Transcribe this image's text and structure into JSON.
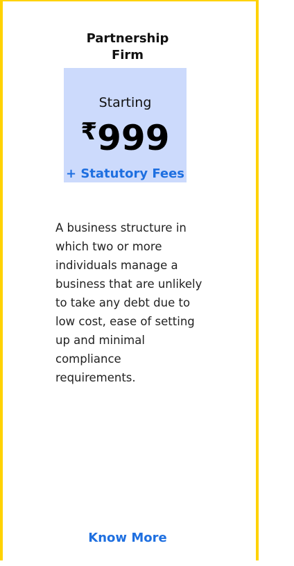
{
  "card": {
    "title": "Partnership Firm",
    "price": {
      "starting_label": "Starting",
      "currency_symbol": "₹",
      "amount": "999",
      "fees_label": "+ Statutory Fees"
    },
    "description": "A business structure in which two or more individuals manage a business that are unlikely to take any debt due to low cost, ease of setting up and minimal compliance requirements.",
    "cta_label": "Know More"
  },
  "colors": {
    "border": "#FFD200",
    "price_box_bg": "#CCDAFC",
    "link": "#1E6FE0"
  }
}
